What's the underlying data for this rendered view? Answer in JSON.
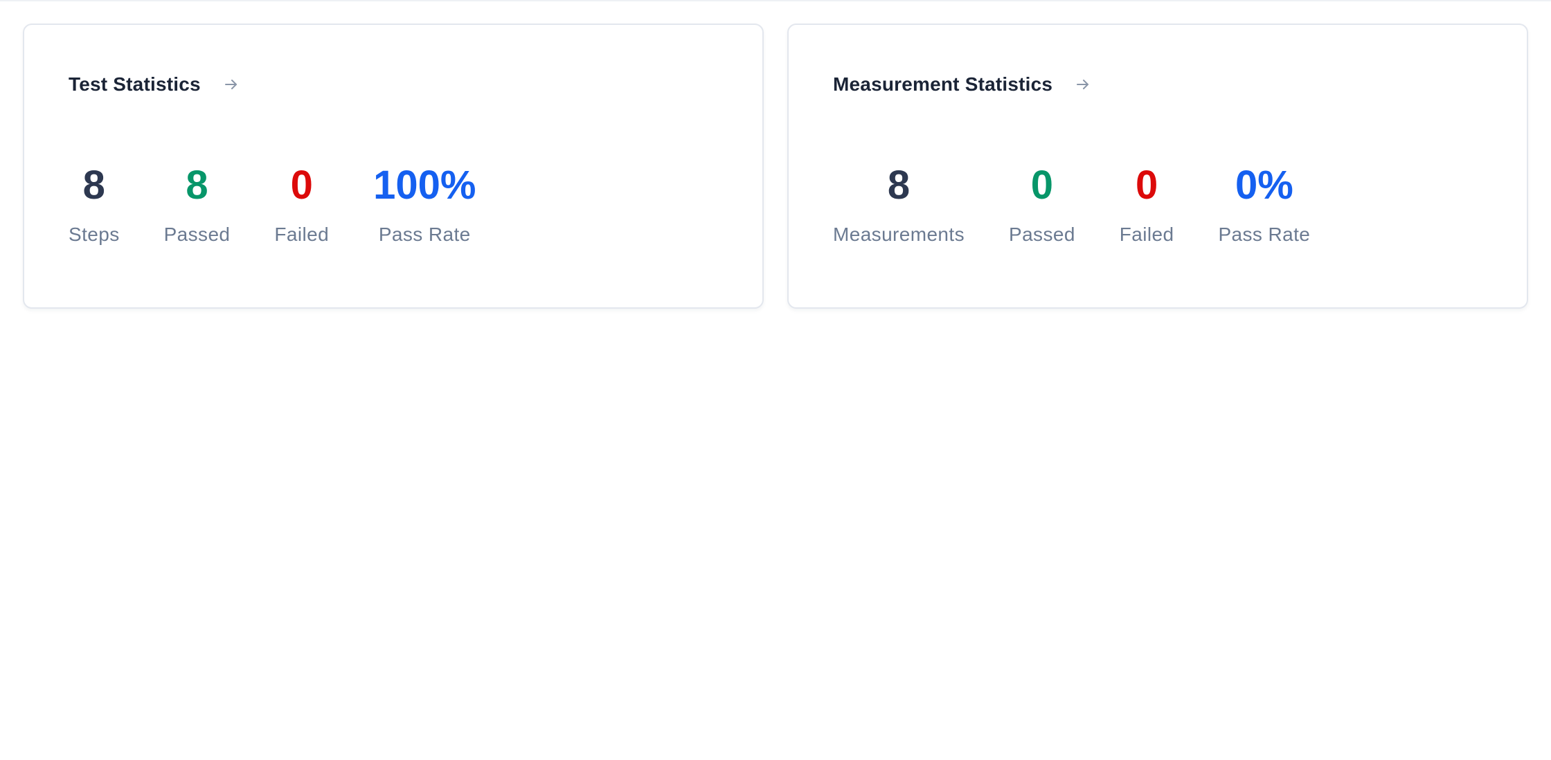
{
  "colors": {
    "neutral": "#2d3850",
    "passed": "#079669",
    "failed": "#dc0a0a",
    "pass_rate": "#1560f0",
    "label": "#6b7a91",
    "title": "#1b2436"
  },
  "cards": [
    {
      "title": "Test Statistics",
      "link_icon": "arrow-right-icon",
      "stats": [
        {
          "value": "8",
          "label": "Steps"
        },
        {
          "value": "8",
          "label": "Passed"
        },
        {
          "value": "0",
          "label": "Failed"
        },
        {
          "value": "100%",
          "label": "Pass Rate"
        }
      ]
    },
    {
      "title": "Measurement Statistics",
      "link_icon": "arrow-right-icon",
      "stats": [
        {
          "value": "8",
          "label": "Measurements"
        },
        {
          "value": "0",
          "label": "Passed"
        },
        {
          "value": "0",
          "label": "Failed"
        },
        {
          "value": "0%",
          "label": "Pass Rate"
        }
      ]
    }
  ]
}
